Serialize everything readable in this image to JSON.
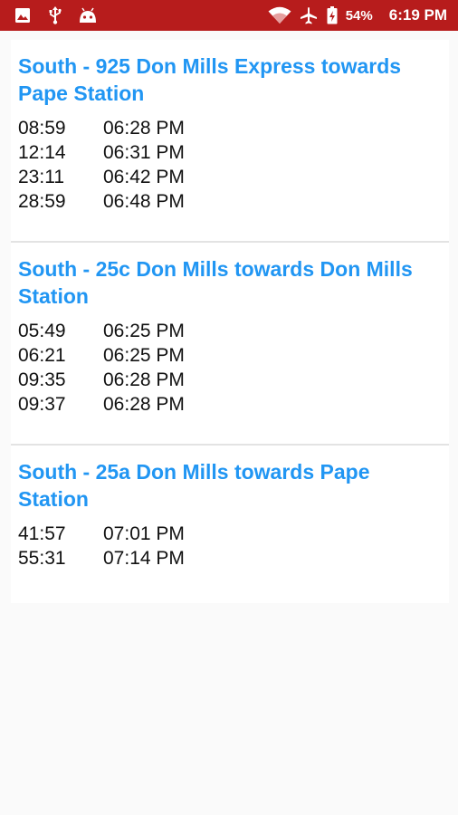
{
  "status_bar": {
    "icons_left": [
      "image-icon",
      "usb-icon",
      "android-icon"
    ],
    "icons_right": [
      "wifi-icon",
      "airplane-icon",
      "battery-charging-icon"
    ],
    "battery": "54%",
    "time": "6:19 PM",
    "background_color": "#b71c1c"
  },
  "routes": [
    {
      "title": "South - 925 Don Mills Express towards Pape Station",
      "arrivals": [
        {
          "wait": "08:59",
          "time": "06:28 PM"
        },
        {
          "wait": "12:14",
          "time": "06:31 PM"
        },
        {
          "wait": "23:11",
          "time": "06:42 PM"
        },
        {
          "wait": "28:59",
          "time": "06:48 PM"
        }
      ]
    },
    {
      "title": "South - 25c Don Mills towards Don Mills Station",
      "arrivals": [
        {
          "wait": "05:49",
          "time": "06:25 PM"
        },
        {
          "wait": "06:21",
          "time": "06:25 PM"
        },
        {
          "wait": "09:35",
          "time": "06:28 PM"
        },
        {
          "wait": "09:37",
          "time": "06:28 PM"
        }
      ]
    },
    {
      "title": "South - 25a Don Mills towards Pape Station",
      "arrivals": [
        {
          "wait": "41:57",
          "time": "07:01 PM"
        },
        {
          "wait": "55:31",
          "time": "07:14 PM"
        }
      ]
    }
  ],
  "colors": {
    "title": "#2196f3",
    "text": "#111111",
    "divider": "#e3e3e3",
    "page_background": "#fafafa"
  }
}
